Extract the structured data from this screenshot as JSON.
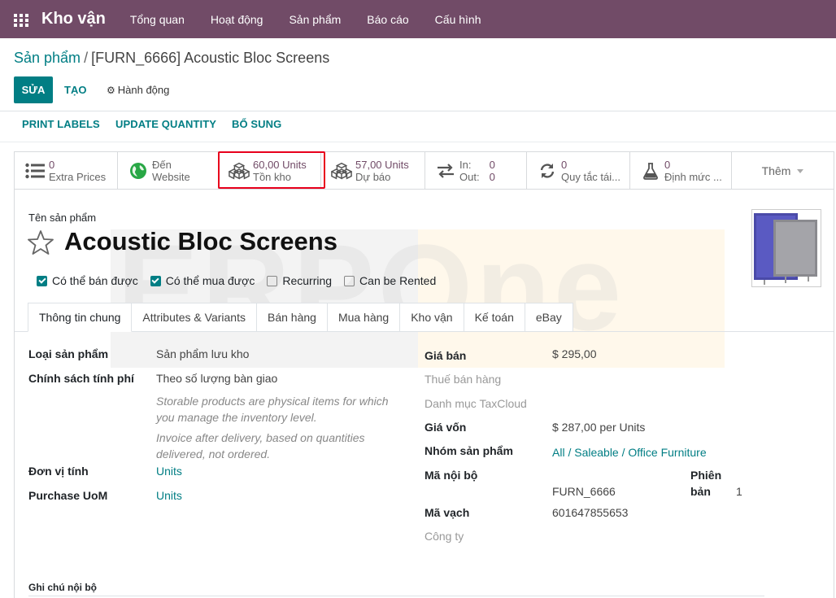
{
  "navbar": {
    "brand": "Kho vận",
    "menu": [
      "Tổng quan",
      "Hoạt động",
      "Sản phẩm",
      "Báo cáo",
      "Cấu hình"
    ]
  },
  "breadcrumb": {
    "parent": "Sản phẩm",
    "separator": "/",
    "current": "[FURN_6666] Acoustic Bloc Screens"
  },
  "control_panel": {
    "edit_label": "SỬA",
    "create_label": "TẠO",
    "action_label": "Hành động"
  },
  "header_buttons": [
    "PRINT LABELS",
    "UPDATE QUANTITY",
    "BỔ SUNG"
  ],
  "smart_buttons": [
    {
      "icon": "list-icon",
      "value": "0",
      "label": "Extra Prices"
    },
    {
      "icon": "globe-icon",
      "value": "Đến",
      "label": "Website"
    },
    {
      "icon": "cubes-icon",
      "value": "60,00 Units",
      "label": "Tồn kho"
    },
    {
      "icon": "cubes-icon",
      "value": "57,00 Units",
      "label": "Dự báo"
    },
    {
      "icon": "exchange-icon",
      "in_label": "In:",
      "in_value": "0",
      "out_label": "Out:",
      "out_value": "0"
    },
    {
      "icon": "refresh-icon",
      "value": "0",
      "label": "Quy tắc tái..."
    },
    {
      "icon": "flask-icon",
      "value": "0",
      "label": "Định mức ..."
    },
    {
      "label": "Thêm"
    }
  ],
  "watermark": {
    "text": "ERPOne"
  },
  "product": {
    "name_label": "Tên sản phẩm",
    "name": "Acoustic Bloc Screens",
    "image_colors": {
      "front": "#4a4aa8",
      "back": "#8a8a8f"
    }
  },
  "checkboxes": [
    {
      "label": "Có thể bán được",
      "checked": true
    },
    {
      "label": "Có thể mua được",
      "checked": true
    },
    {
      "label": "Recurring",
      "checked": false
    },
    {
      "label": "Can be Rented",
      "checked": false
    }
  ],
  "tabs": [
    "Thông tin chung",
    "Attributes & Variants",
    "Bán hàng",
    "Mua hàng",
    "Kho vận",
    "Kế toán",
    "eBay"
  ],
  "left_fields": {
    "product_type_label": "Loại sản phẩm",
    "product_type_value": "Sản phẩm lưu kho",
    "invoice_policy_label": "Chính sách tính phí",
    "invoice_policy_value": "Theo số lượng bàn giao",
    "help_storable": "Storable products are physical items for which you manage the inventory level.",
    "help_invoice": "Invoice after delivery, based on quantities delivered, not ordered.",
    "uom_label": "Đơn vị tính",
    "uom_value": "Units",
    "purchase_uom_label": "Purchase UoM",
    "purchase_uom_value": "Units"
  },
  "right_fields": {
    "sale_price_label": "Giá bán",
    "sale_price_value": "$ 295,00",
    "sales_tax_label": "Thuế bán hàng",
    "taxcloud_label": "Danh mục TaxCloud",
    "cost_label": "Giá vốn",
    "cost_value": "$ 287,00",
    "cost_unit": "per Units",
    "category_label": "Nhóm sản phẩm",
    "category_value": "All / Saleable / Office Furniture",
    "internal_ref_label": "Mã nội bộ",
    "internal_ref_value": "FURN_6666",
    "version_label_1": "Phiên",
    "version_label_2": "bản",
    "version_value": "1",
    "barcode_label": "Mã vạch",
    "barcode_value": "601647855653",
    "company_label": "Công ty"
  },
  "notes": {
    "internal_label": "Ghi chú nội bộ"
  }
}
